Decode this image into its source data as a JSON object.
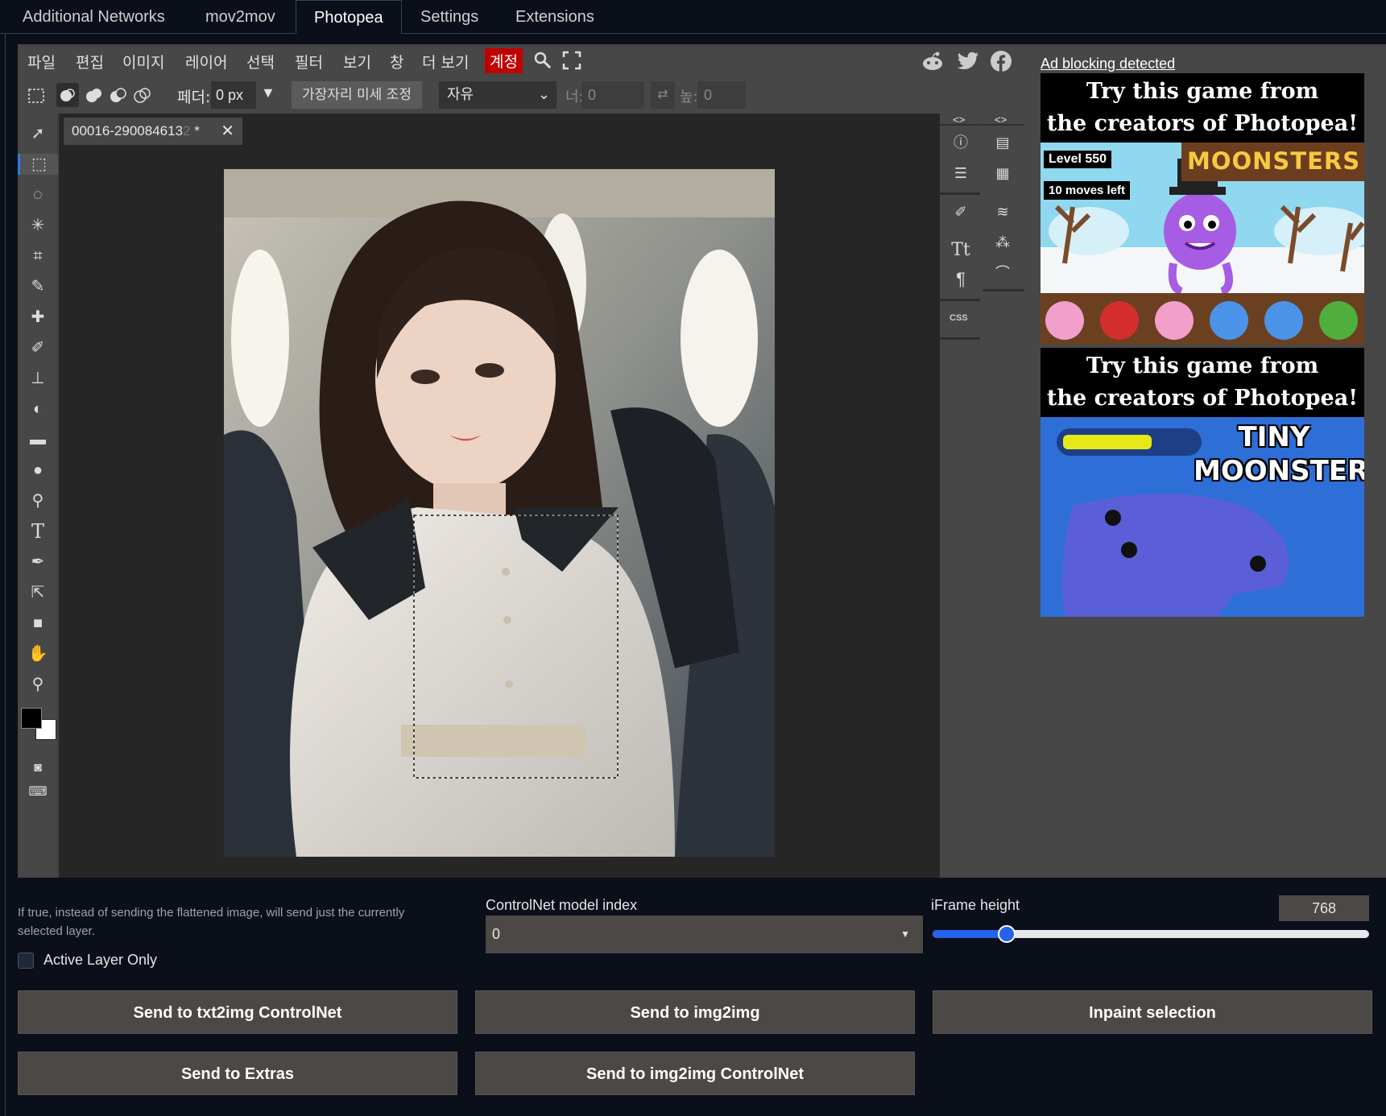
{
  "tabs": {
    "additional_networks": "Additional Networks",
    "mov2mov": "mov2mov",
    "photopea": "Photopea",
    "settings": "Settings",
    "extensions": "Extensions"
  },
  "menu": {
    "file": "파일",
    "edit": "편집",
    "image": "이미지",
    "layer": "레이어",
    "select": "선택",
    "filter": "필터",
    "view": "보기",
    "window": "창",
    "more": "더 보기",
    "account": "계정"
  },
  "options": {
    "feather_label": "페더:",
    "feather_value": "0 px",
    "refine_edge": "가장자리 미세 조정",
    "style_value": "자유",
    "width_label": "너:",
    "width_value": "0",
    "height_label": "높:",
    "height_value": "0"
  },
  "document": {
    "tab_name": "00016-290084613",
    "tab_name_faded": "2",
    "modified": "*"
  },
  "panels": {
    "css_label": "CSS",
    "collapse": "<>"
  },
  "ad": {
    "blocking_text": "Ad blocking detected",
    "headline1a": "Try this game from",
    "headline1b": "the creators of Photopea!",
    "game1_title": "MOONSTERS",
    "game1_level": "Level 550",
    "game1_moves": "10 moves left",
    "headline2a": "Try this game from",
    "headline2b": "the creators of Photopea!",
    "game2_title_a": "TINY",
    "game2_title_b": "MOONSTERS"
  },
  "bottom": {
    "active_layer_desc": "If true, instead of sending the flattened image, will send just the currently selected layer.",
    "active_layer_label": "Active Layer Only",
    "controlnet_label": "ControlNet model index",
    "controlnet_value": "0",
    "iframe_label": "iFrame height",
    "iframe_value": "768",
    "iframe_min": 0,
    "iframe_max": 4000,
    "iframe_level": 0.17,
    "btn_txt2img": "Send to txt2img ControlNet",
    "btn_img2img": "Send to img2img",
    "btn_inpaint": "Inpaint selection",
    "btn_extras": "Send to Extras",
    "btn_img2img_cn": "Send to img2img ControlNet"
  },
  "colors": {
    "accent_red": "#c00000",
    "slider_blue": "#2563eb",
    "panel_gray": "#474747"
  }
}
